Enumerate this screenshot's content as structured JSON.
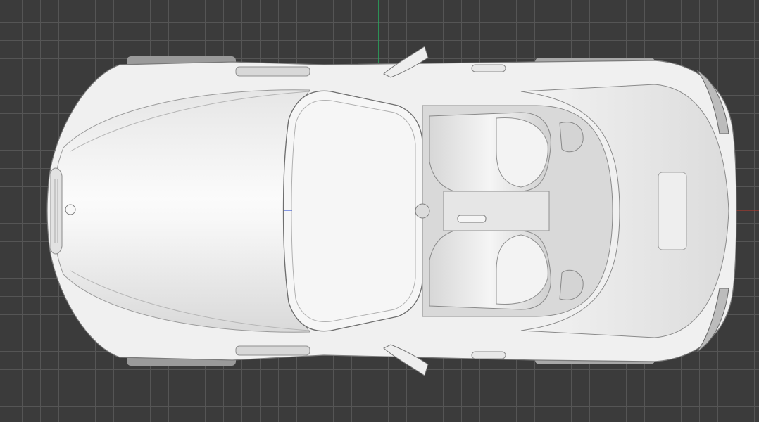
{
  "viewport": {
    "background": "#3b3b3b",
    "grid_color": "#555555",
    "axis_x_color": "#c0392b",
    "axis_y_color": "#27ae60",
    "axis_z_color": "#3c5ad6"
  },
  "model": {
    "body_color": "#f2f2f2",
    "shadow_color": "#cfcfcf",
    "trim_color": "#8a8a8a"
  }
}
